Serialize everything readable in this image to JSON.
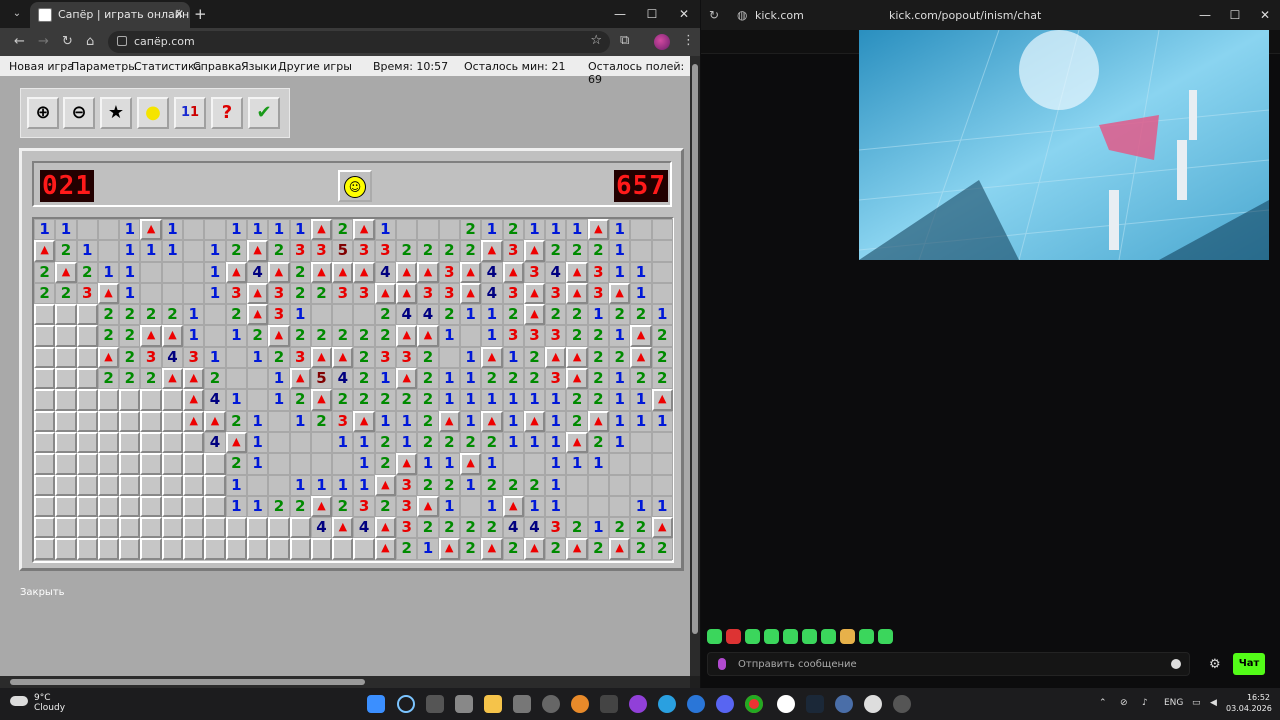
{
  "browser": {
    "tab_title": "Сапёр | играть онлайн беспла",
    "url": "сапёр.com",
    "new_tab": "+"
  },
  "menu": {
    "items": [
      "Новая игра",
      "Параметры",
      "Статистика",
      "Справка",
      "Языки",
      "Другие игры"
    ],
    "time": "Время: 10:57",
    "mines_left": "Осталось мин: 21",
    "fields_left": "Осталось полей: 69"
  },
  "toolbar_icons": [
    "zoom-in-icon",
    "zoom-out-icon",
    "star-icon",
    "hint-bulb-icon",
    "numbers-icon",
    "help-icon",
    "check-icon"
  ],
  "game": {
    "mine_counter": "021",
    "timer": "657",
    "close_label": "Закрыть",
    "board": [
      "1 1 . . 1 F 1 . . 1 1 1 1 F 2 F 1 . . . 2 1 2 1 1 1 F 1 . .",
      "F 2 1 . 1 1 1 . 1 2 F 2 3 3 5 3 3 2 2 2 2 F 3 F 2 2 2 1 . .",
      "2 F 2 1 1 . . . 1 F 4 F 2 F F F 4 F F 3 F 4 F 3 4 F 3 1 1 .",
      "2 2 3 F 1 . . . 1 3 F 3 2 2 3 3 F F 3 3 F 4 3 F 3 F 3 F 1 .",
      "# # # 2 2 2 2 1 . 2 F 3 1 . . . 2 4 4 2 1 1 2 F 2 2 1 2 2 1",
      "# # # 2 2 F F 1 . 1 2 F 2 2 2 2 2 F F 1 . 1 3 3 3 2 2 1 F 2",
      "# # # F 2 3 4 3 1 . 1 2 3 F F 2 3 3 2 . 1 F 1 2 F F 2 2 F 2",
      "# # # 2 2 2 F F 2 . . 1 F 5 4 2 1 F 2 1 1 2 2 2 3 F 2 1 2 2",
      "# # # # # # # F 4 1 . 1 2 F 2 2 2 2 2 1 1 1 1 1 1 2 2 1 1 F",
      "# # # # # # # F F 2 1 . 1 2 3 F 1 1 2 F 1 F 1 F 1 2 F 1 1 1",
      "# # # # # # # # 4 F 1 . . . 1 1 2 1 2 2 2 2 1 1 1 F 2 1 . .",
      "# # # # # # # # # 2 1 . . . . 1 2 F 1 1 F 1 . . 1 1 1 . . .",
      "# # # # # # # # # 1 . . 1 1 1 1 F 3 2 2 1 2 2 2 1 . . . . .",
      "# # # # # # # # # 1 1 2 2 F 2 3 2 3 F 1 . 1 F 1 1 . . . 1 1",
      "# # # # # # # # # # # # # 4 F 4 F 3 2 2 2 2 4 4 3 2 1 2 2 F",
      "# # # # # # # # # # # # # # # # F 2 1 F 2 F 2 F 2 F 2 F 2 2"
    ]
  },
  "kick": {
    "domain": "kick.com",
    "url": "kick.com/popout/inism/chat",
    "chat_placeholder": "Отправить сообщение",
    "chat_button": "Чат"
  },
  "taskbar": {
    "temp": "9°C",
    "weather": "Cloudy",
    "lang": "ENG",
    "time": "16:52",
    "date": "03.04.2026"
  }
}
